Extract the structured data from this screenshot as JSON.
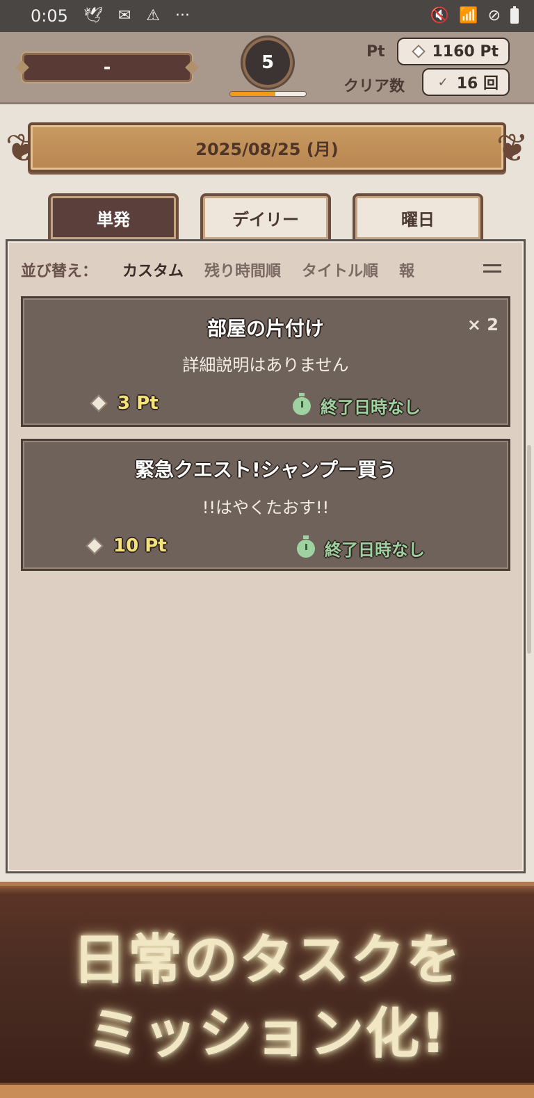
{
  "status_bar": {
    "time": "0:05",
    "left_icons": [
      "bird-icon",
      "voicemail-icon",
      "warning-icon",
      "more-dots-icon"
    ],
    "more_dots": "···",
    "right_icons": [
      "mute-icon",
      "wifi-icon",
      "block-icon",
      "battery-icon"
    ]
  },
  "header": {
    "player_name": "-",
    "level": "5",
    "exp_progress": 0.6,
    "pt_label": "Pt",
    "pt_value": "1160 Pt",
    "clear_label": "クリア数",
    "clear_value": "16 回"
  },
  "date": "2025/08/25 (月)",
  "tabs": [
    {
      "label": "単発",
      "active": true
    },
    {
      "label": "デイリー",
      "active": false
    },
    {
      "label": "曜日",
      "active": false
    }
  ],
  "sort": {
    "label": "並び替え：",
    "options": [
      "カスタム",
      "残り時間順",
      "タイトル順",
      "報"
    ],
    "selected": "カスタム"
  },
  "quests": [
    {
      "title": "部屋の片付け",
      "description": "詳細説明はありません",
      "points": "3 Pt",
      "deadline": "終了日時なし",
      "multiplier": "× 2"
    },
    {
      "title": "緊急クエスト!シャンプー買う",
      "description": "!!はやくたおす!!",
      "points": "10 Pt",
      "deadline": "終了日時なし",
      "multiplier": ""
    }
  ],
  "promo": {
    "line1": "日常のタスクを",
    "line2": "ミッション化!"
  },
  "colors": {
    "accent_orange": "#f29b1b",
    "points_yellow": "#f6e27a",
    "deadline_green": "#9ed3a1",
    "card_brown": "#6f625a"
  }
}
